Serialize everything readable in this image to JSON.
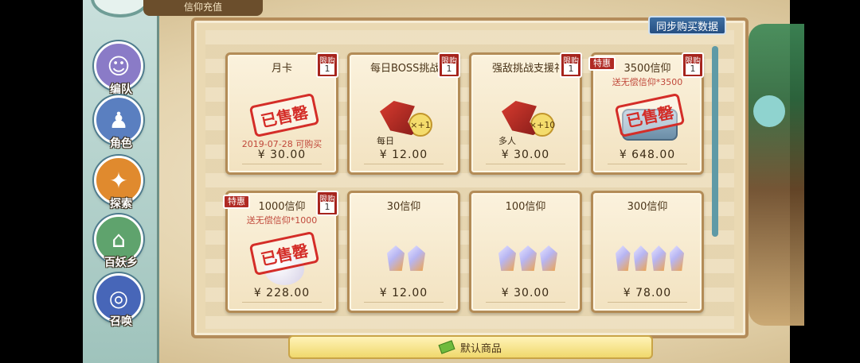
{
  "window": {
    "title": "信仰充值"
  },
  "header": {
    "sync_button": "同步购买数据"
  },
  "nav": [
    {
      "label": "编队",
      "icon": "ghost-icon",
      "color": "#8a7bc7"
    },
    {
      "label": "角色",
      "icon": "character-portrait-icon",
      "color": "#5a7fc0"
    },
    {
      "label": "探索",
      "icon": "compass-icon",
      "color": "#e08a2e"
    },
    {
      "label": "百妖乡",
      "icon": "village-icon",
      "color": "#5fa36d"
    },
    {
      "label": "召唤",
      "icon": "spiral-icon",
      "color": "#4766b8"
    }
  ],
  "cards": [
    {
      "name": "月卡",
      "limit": "1",
      "limit_label": "限购",
      "price": "¥ 30.00",
      "sold_out": true,
      "sold_label": "已售罄",
      "date_text": "2019-07-28 可购买",
      "art": "moon-card"
    },
    {
      "name": "每日BOSS挑战礼",
      "limit": "1",
      "limit_label": "限购",
      "price": "¥ 12.00",
      "art": "dragon-daily",
      "multiplier": "×+1",
      "tag": "每日"
    },
    {
      "name": "强敌挑战支援礼包",
      "limit": "1",
      "limit_label": "限购",
      "price": "¥ 30.00",
      "art": "dragon-multi",
      "multiplier": "×+10",
      "tag": "多人"
    },
    {
      "name": "3500信仰",
      "limit": "1",
      "limit_label": "限购",
      "special": "特惠",
      "bonus": "送无偿信仰*3500",
      "price": "¥ 648.00",
      "sold_out": true,
      "sold_label": "已售罄",
      "art": "chest"
    },
    {
      "name": "1000信仰",
      "limit": "1",
      "limit_label": "限购",
      "special": "特惠",
      "bonus": "送无偿信仰*1000",
      "price": "¥ 228.00",
      "sold_out": true,
      "sold_label": "已售罄",
      "art": "egg"
    },
    {
      "name": "30信仰",
      "price": "¥ 12.00",
      "art": "crystals-2"
    },
    {
      "name": "100信仰",
      "price": "¥ 30.00",
      "art": "crystals-3"
    },
    {
      "name": "300信仰",
      "price": "¥ 78.00",
      "art": "crystals-4"
    }
  ],
  "footer": {
    "label": "默认商品"
  }
}
